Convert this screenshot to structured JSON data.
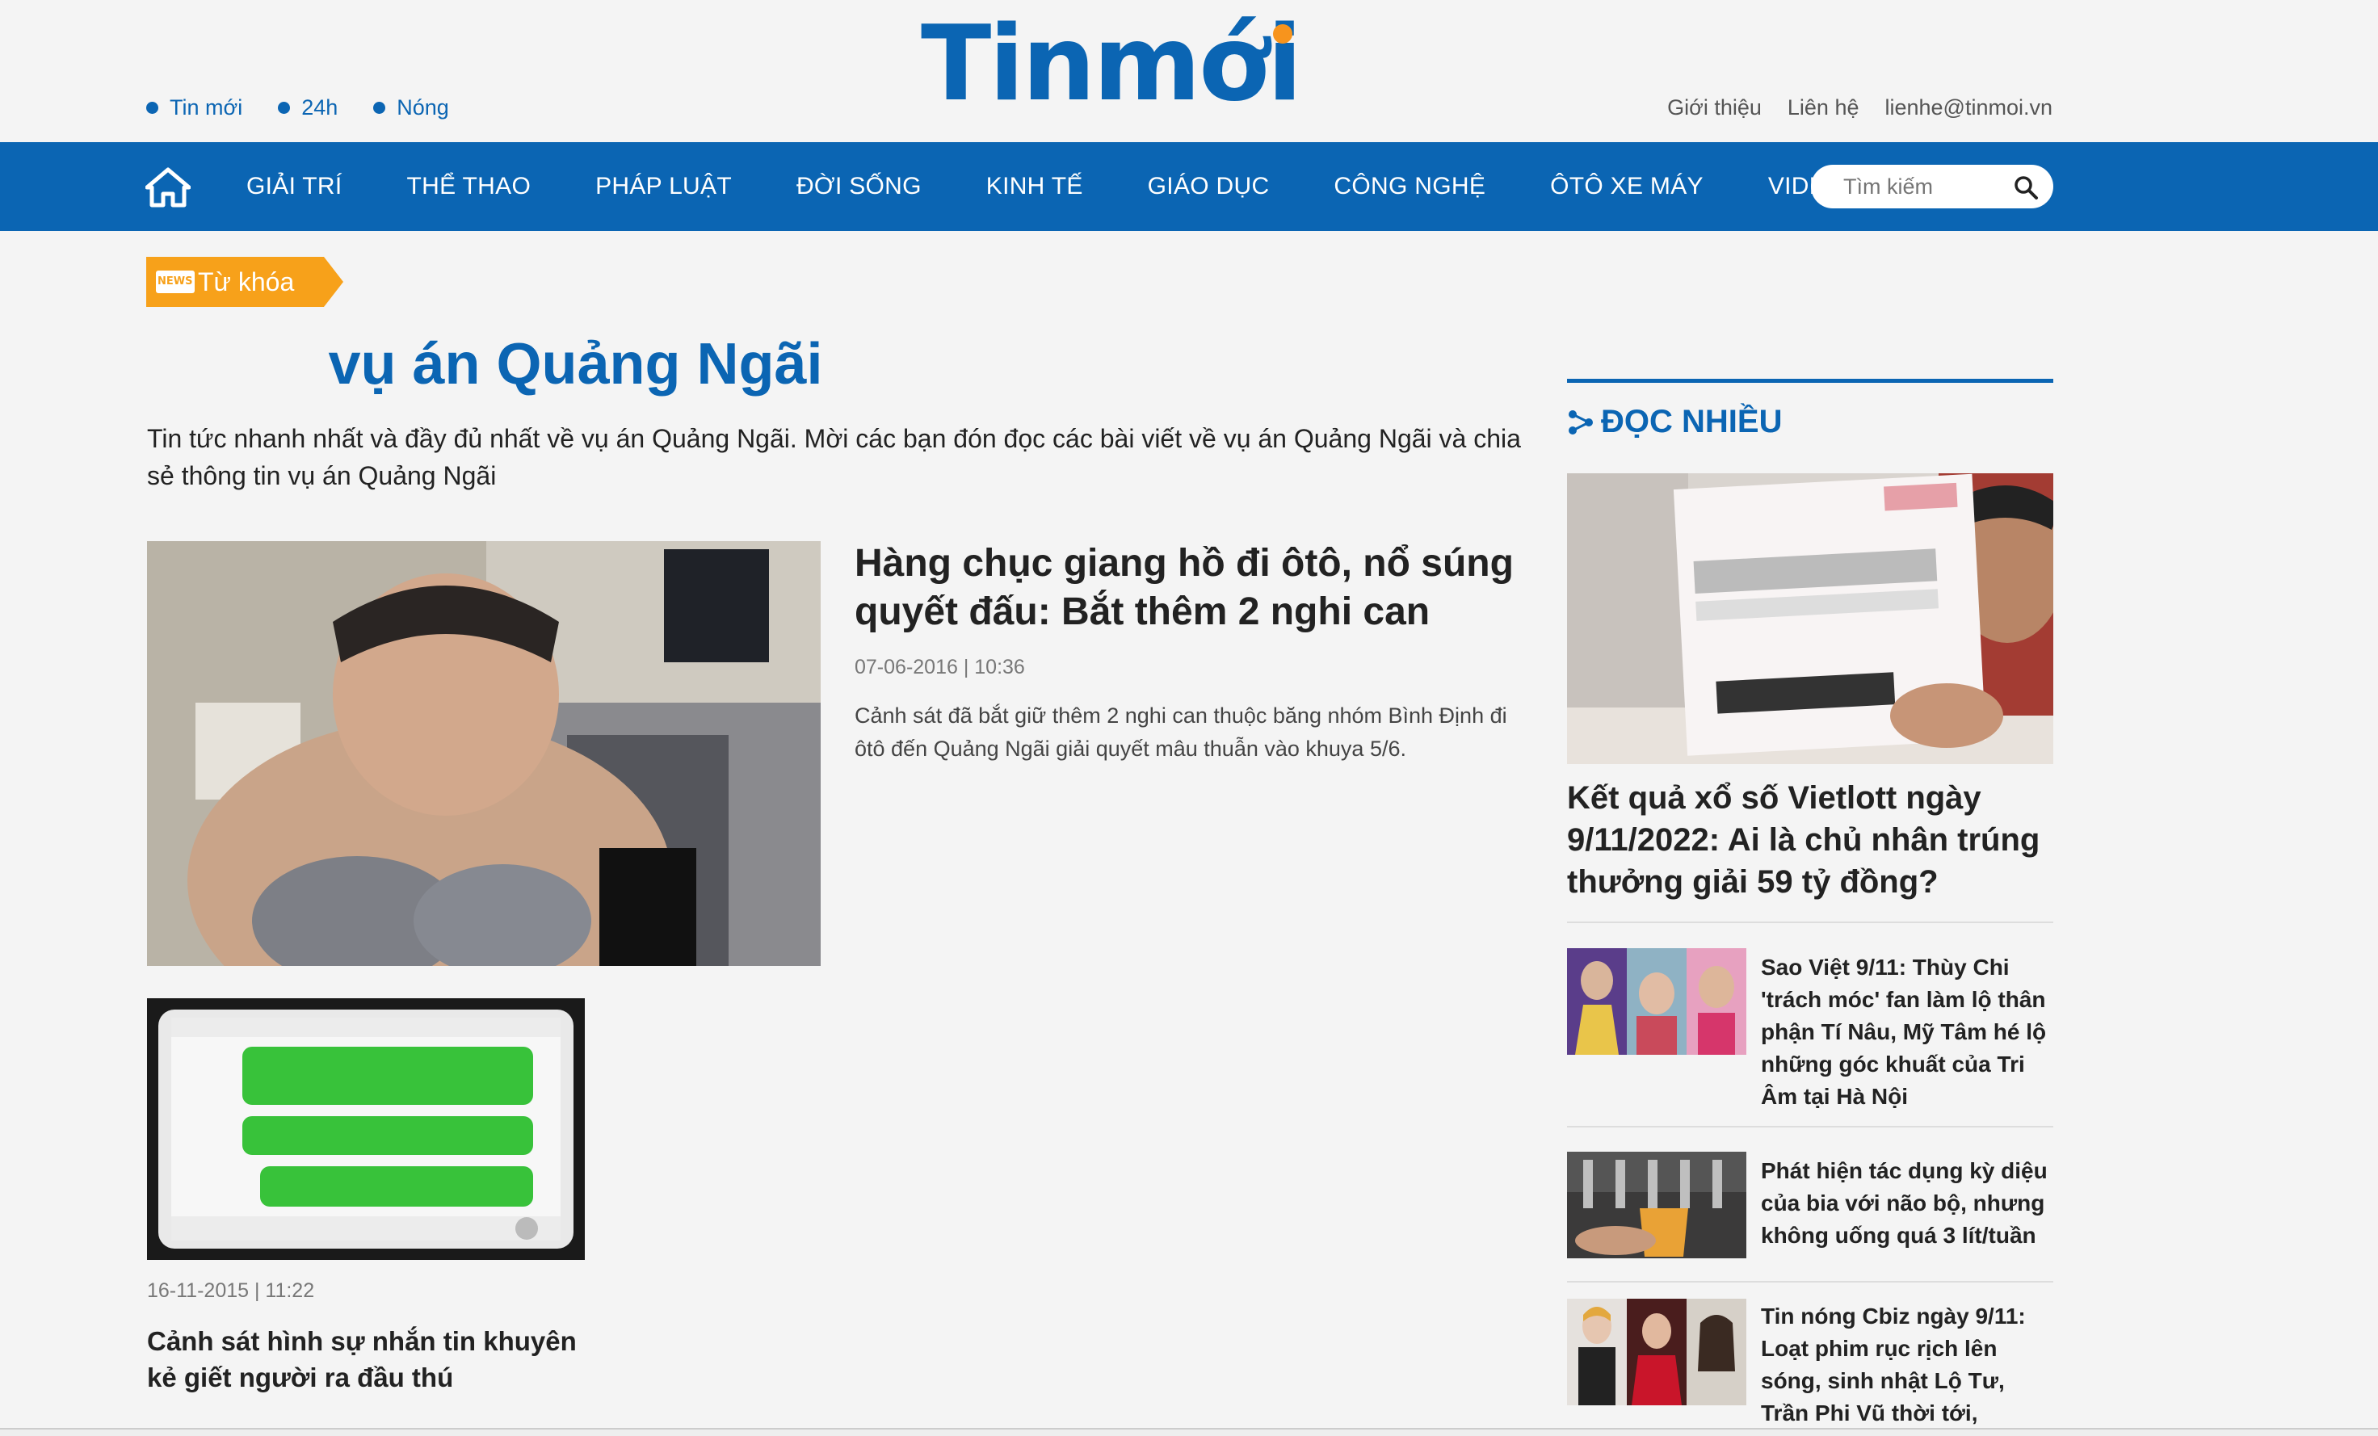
{
  "header": {
    "quick_links": [
      "Tin mới",
      "24h",
      "Nóng"
    ],
    "logo_text": "Tinmới",
    "right_links": [
      "Giới thiệu",
      "Liên hệ",
      "lienhe@tinmoi.vn"
    ]
  },
  "nav": {
    "items": [
      "GIẢI TRÍ",
      "THỂ THAO",
      "PHÁP LUẬT",
      "ĐỜI SỐNG",
      "KINH TẾ",
      "GIÁO DỤC",
      "CÔNG NGHỆ",
      "ÔTÔ XE MÁY",
      "VIDEO"
    ],
    "search_placeholder": "Tìm kiếm"
  },
  "tag": {
    "label": "Từ khóa"
  },
  "main": {
    "title": "vụ án Quảng Ngãi",
    "description": "Tin tức nhanh nhất và đầy đủ nhất về vụ án Quảng Ngãi. Mời các bạn đón đọc các bài viết về vụ án Quảng Ngãi và chia sẻ thông tin vụ án Quảng Ngãi",
    "featured": {
      "title": "Hàng chục giang hồ đi ôtô, nổ súng quyết đấu: Bắt thêm 2 nghi can",
      "date": "07-06-2016 | 10:36",
      "summary": "Cảnh sát đã bắt giữ thêm 2 nghi can thuộc băng nhóm Bình Định đi ôtô đến Quảng Ngãi giải quyết mâu thuẫn vào khuya 5/6."
    },
    "second": {
      "date": "16-11-2015 | 11:22",
      "title": "Cảnh sát hình sự nhắn tin khuyên kẻ giết người ra đầu thú"
    }
  },
  "sidebar": {
    "heading": "ĐỌC NHIỀU",
    "top_title": "Kết quả xổ số Vietlott ngày 9/11/2022: Ai là chủ nhân trúng thưởng giải 59 tỷ đồng?",
    "items": [
      {
        "title": "Sao Việt 9/11: Thùy Chi 'trách móc' fan làm lộ thân phận Tí Nâu, Mỹ Tâm hé lộ những góc khuất của Tri Âm tại Hà Nội"
      },
      {
        "title": "Phát hiện tác dụng kỳ diệu của bia với não bộ, nhưng không uống quá 3 lít/tuần"
      },
      {
        "title": "Tin nóng Cbiz ngày 9/11: Loạt phim rục rịch lên sóng, sinh nhật Lộ Tư, Trần Phi Vũ thời tới, Dương Tử công khai"
      }
    ]
  },
  "colors": {
    "brand_blue": "#0b65b3",
    "accent_orange": "#f7a11a",
    "background": "#f4f4f4"
  }
}
